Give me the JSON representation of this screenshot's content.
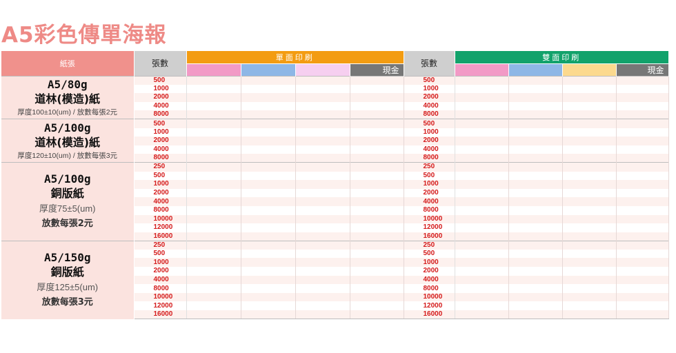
{
  "title": "A5彩色傳單海報",
  "header": {
    "paper_label": "紙張",
    "qty_label": "張數",
    "single_label": "單面印刷",
    "double_label": "雙面印刷",
    "cash_label": "現金"
  },
  "colors": {
    "title": "#ee8a86",
    "paper_header": "#f0918c",
    "single_band": "#f39c12",
    "double_band": "#12a26b",
    "swatches": [
      "#f29ac6",
      "#8eb7e6",
      "#f6cff0",
      "#fcd98e"
    ],
    "qty_text": "#d51b1b"
  },
  "papers": [
    {
      "size": "A5/80g",
      "name": "道林(模造)紙",
      "spec": "厚度100±10(um) / 放數每張2元",
      "quantities": [
        "500",
        "1000",
        "2000",
        "4000",
        "8000"
      ]
    },
    {
      "size": "A5/100g",
      "name": "道林(模造)紙",
      "spec": "厚度120±10(um) / 放數每張3元",
      "quantities": [
        "500",
        "1000",
        "2000",
        "4000",
        "8000"
      ]
    },
    {
      "size": "A5/100g",
      "name": "銅版紙",
      "spec_line1": "厚度75±5(um)",
      "spec_line2": "放數每張2元",
      "quantities": [
        "250",
        "500",
        "1000",
        "2000",
        "4000",
        "8000",
        "10000",
        "12000",
        "16000"
      ]
    },
    {
      "size": "A5/150g",
      "name": "銅版紙",
      "spec_line1": "厚度125±5(um)",
      "spec_line2": "放數每張3元",
      "quantities": [
        "250",
        "500",
        "1000",
        "2000",
        "4000",
        "8000",
        "10000",
        "12000",
        "16000"
      ]
    }
  ]
}
